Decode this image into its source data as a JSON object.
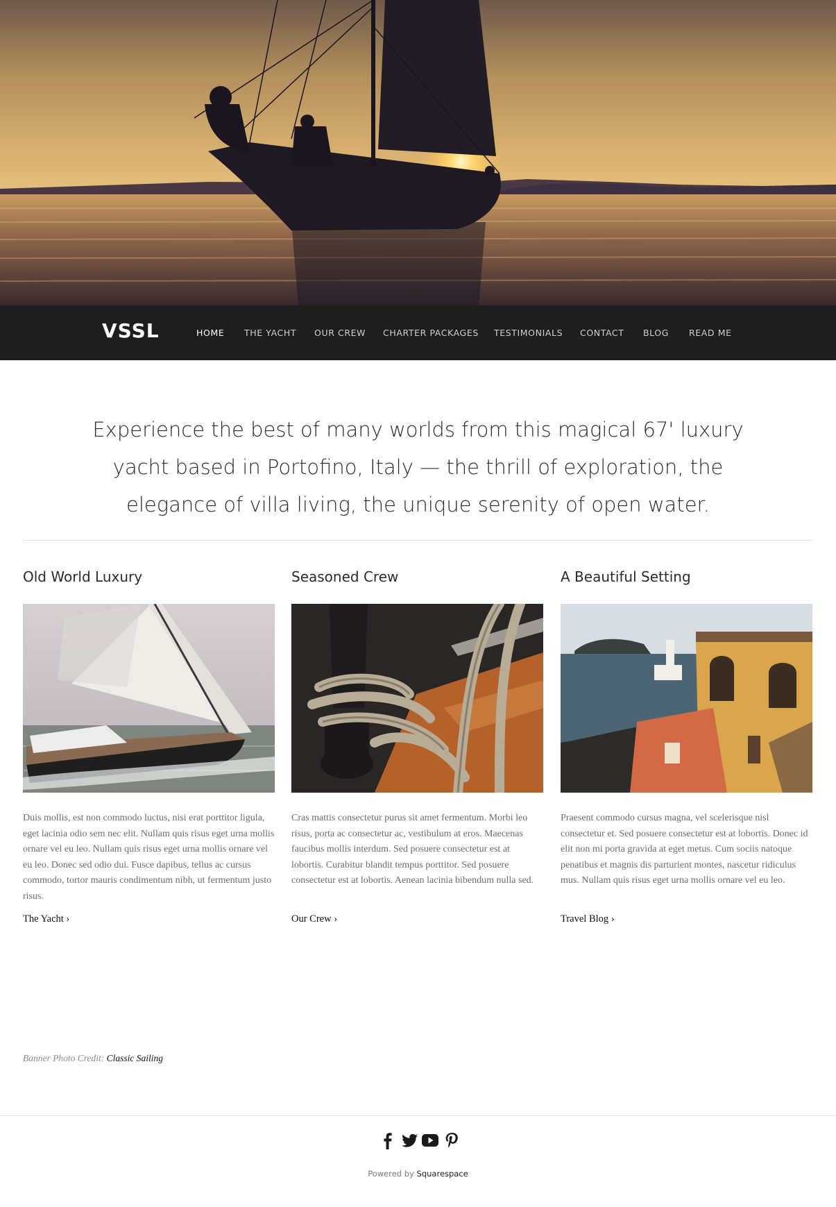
{
  "site": {
    "logo": "VSSL"
  },
  "nav": {
    "items": [
      {
        "label": "HOME",
        "active": true
      },
      {
        "label": "THE YACHT",
        "active": false
      },
      {
        "label": "OUR CREW",
        "active": false
      },
      {
        "label": "CHARTER PACKAGES",
        "active": false
      },
      {
        "label": "TESTIMONIALS",
        "active": false
      },
      {
        "label": "CONTACT",
        "active": false
      },
      {
        "label": "BLOG",
        "active": false
      },
      {
        "label": "READ ME",
        "active": false
      }
    ]
  },
  "intro": {
    "text": "Experience the best of many worlds from this magical 67' luxury yacht based in Portofino, Italy — the thrill of exploration, the elegance of villa living, the unique serenity of open water."
  },
  "features": [
    {
      "title": "Old World Luxury",
      "body": "Duis mollis, est non commodo luctus, nisi erat porttitor ligula, eget lacinia odio sem nec elit. Nullam quis risus eget urna mollis ornare vel eu leo. Nullam quis risus eget urna mollis ornare vel eu leo. Donec sed odio dui. Fusce dapibus, tellus ac cursus commodo, tortor mauris condimentum nibh, ut fermentum justo risus.",
      "link": "The Yacht ›"
    },
    {
      "title": "Seasoned Crew",
      "body": "Cras mattis consectetur purus sit amet fermentum. Morbi leo risus, porta ac consectetur ac, vestibulum at eros. Maecenas faucibus mollis interdum. Sed posuere consectetur est at lobortis. Curabitur blandit tempus porttitor. Sed posuere consectetur est at lobortis. Aenean lacinia bibendum nulla sed.",
      "link": "Our Crew ›"
    },
    {
      "title": "A Beautiful Setting",
      "body": " Praesent commodo cursus magna, vel scelerisque nisl consectetur et. Sed posuere consectetur est at lobortis. Donec id elit non mi porta gravida at eget metus. Cum sociis natoque penatibus et magnis dis parturient montes, nascetur ridiculus mus. Nullam quis risus eget urna mollis ornare vel eu leo.",
      "link": "Travel Blog ›"
    }
  ],
  "credit": {
    "label": "Banner Photo Credit:",
    "link": "Classic Sailing"
  },
  "footer": {
    "social_icons": [
      "facebook-icon",
      "twitter-icon",
      "youtube-icon",
      "pinterest-icon"
    ],
    "powered_prefix": "Powered by",
    "powered_link": "Squarespace"
  },
  "colors": {
    "nav_bg": "#1e1e1e",
    "nav_text": "#cfcfcf",
    "body_text": "#6c6c6c",
    "heading_text": "#2b2b2b"
  }
}
